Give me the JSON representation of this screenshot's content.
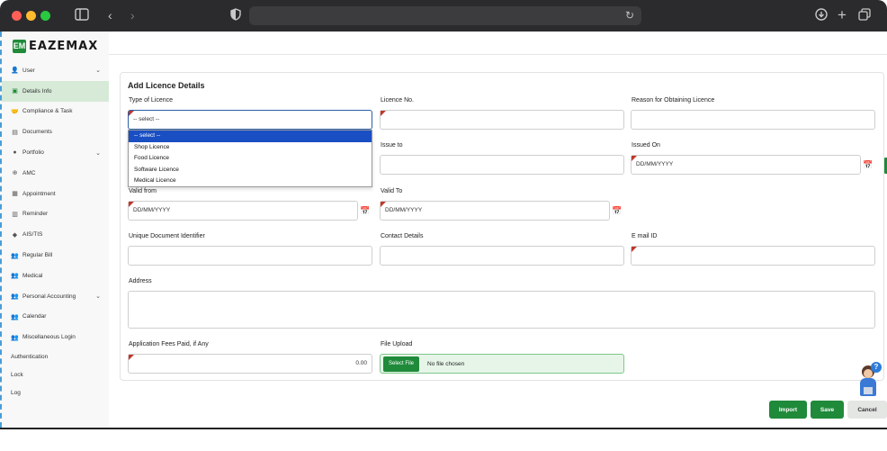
{
  "browser": {
    "icons": [
      "sidebar-icon",
      "back-icon",
      "forward-icon",
      "shield-icon",
      "reload-icon",
      "download-icon",
      "new-tab-icon",
      "tabs-icon"
    ]
  },
  "brand": {
    "mark": "EM",
    "name": "EAZEMAX",
    "accent": "#1f8a3a"
  },
  "sidebar": {
    "items": [
      {
        "label": "User",
        "icon": "user-icon",
        "has_children": true
      },
      {
        "label": "Details Info",
        "icon": "info-icon",
        "active": true
      },
      {
        "label": "Compliance & Task",
        "icon": "handshake-icon"
      },
      {
        "label": "Documents",
        "icon": "documents-icon"
      },
      {
        "label": "Portfolio",
        "icon": "portfolio-icon",
        "has_children": true
      },
      {
        "label": "AMC",
        "icon": "globe-icon"
      },
      {
        "label": "Appointment",
        "icon": "calendar-icon"
      },
      {
        "label": "Reminder",
        "icon": "note-icon"
      },
      {
        "label": "AIS/TIS",
        "icon": "tag-icon"
      },
      {
        "label": "Regular Bill",
        "icon": "users-icon"
      },
      {
        "label": "Medical",
        "icon": "users-icon"
      },
      {
        "label": "Personal Accounting",
        "icon": "users-icon",
        "has_children": true
      },
      {
        "label": "Calendar",
        "icon": "users-icon"
      },
      {
        "label": "Miscellaneous Login",
        "icon": "users-icon"
      }
    ],
    "plain_items": [
      "Authentication",
      "Lock",
      "Log"
    ]
  },
  "form": {
    "title": "Add Licence Details",
    "type_of_licence": {
      "label": "Type of Licence",
      "value": "-- select --",
      "options": [
        "-- select --",
        "Shop Licence",
        "Food Licence",
        "Software Licence",
        "Medical Licence"
      ]
    },
    "licence_no": {
      "label": "Licence No.",
      "value": ""
    },
    "reason": {
      "label": "Reason for Obtaining Licence",
      "value": ""
    },
    "issue_to": {
      "label": "Issue to",
      "value": ""
    },
    "issued_on": {
      "label": "Issued On",
      "placeholder": "DD/MM/YYYY"
    },
    "valid_from": {
      "label": "Valid from",
      "placeholder": "DD/MM/YYYY"
    },
    "valid_to": {
      "label": "Valid To",
      "placeholder": "DD/MM/YYYY"
    },
    "unique_doc_id": {
      "label": "Unique Document Identifier",
      "value": ""
    },
    "contact_details": {
      "label": "Contact Details",
      "value": ""
    },
    "email_id": {
      "label": "E mail ID",
      "value": ""
    },
    "address": {
      "label": "Address",
      "value": ""
    },
    "fees": {
      "label": "Application Fees Paid, if Any",
      "value": "0.00"
    },
    "file_upload": {
      "label": "File Upload",
      "button": "Select File",
      "status": "No file chosen"
    }
  },
  "actions": {
    "import": "Import",
    "save": "Save",
    "cancel": "Cancel"
  },
  "help_icon": "help-assistant-icon",
  "colors": {
    "required_marker": "#c0392b",
    "dropdown_highlight": "#1a4fc4",
    "button_green": "#1f8a3a"
  }
}
